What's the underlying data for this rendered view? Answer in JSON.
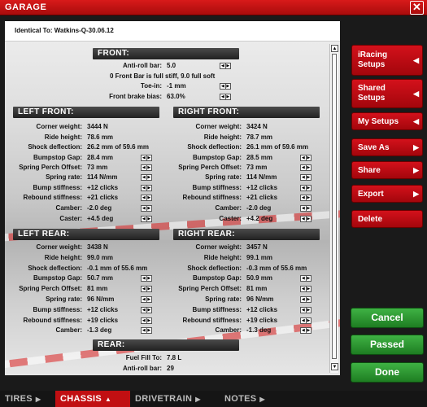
{
  "window": {
    "title": "GARAGE",
    "close": "✕"
  },
  "setup": {
    "identical_to": "Identical To: Watkins-Q-30.06.12"
  },
  "front": {
    "header": "FRONT:",
    "anti_roll_label": "Anti-roll bar:",
    "anti_roll_value": "5.0",
    "note": "0 Front Bar is full stiff, 9.0 full soft",
    "toe_label": "Toe-in:",
    "toe_value": "-1 mm",
    "brake_label": "Front brake bias:",
    "brake_value": "63.0%"
  },
  "left_front": {
    "header": "LEFT FRONT:",
    "rows": [
      {
        "label": "Corner weight:",
        "value": "3444 N"
      },
      {
        "label": "Ride height:",
        "value": "78.6 mm"
      },
      {
        "label": "Shock deflection:",
        "value": "26.2 mm  of  59.6 mm"
      },
      {
        "label": "Bumpstop Gap:",
        "value": "28.4 mm"
      },
      {
        "label": "Spring Perch Offset:",
        "value": "73 mm"
      },
      {
        "label": "Spring rate:",
        "value": "114 N/mm"
      },
      {
        "label": "Bump stiffness:",
        "value": "+12 clicks"
      },
      {
        "label": "Rebound stiffness:",
        "value": "+21 clicks"
      },
      {
        "label": "Camber:",
        "value": "-2.0 deg"
      },
      {
        "label": "Caster:",
        "value": "+4.5 deg"
      }
    ]
  },
  "right_front": {
    "header": "RIGHT FRONT:",
    "rows": [
      {
        "label": "Corner weight:",
        "value": "3424 N"
      },
      {
        "label": "Ride height:",
        "value": "78.7 mm"
      },
      {
        "label": "Shock deflection:",
        "value": "26.1 mm  of  59.6 mm"
      },
      {
        "label": "Bumpstop Gap:",
        "value": "28.5 mm"
      },
      {
        "label": "Spring Perch Offset:",
        "value": "73 mm"
      },
      {
        "label": "Spring rate:",
        "value": "114 N/mm"
      },
      {
        "label": "Bump stiffness:",
        "value": "+12 clicks"
      },
      {
        "label": "Rebound stiffness:",
        "value": "+21 clicks"
      },
      {
        "label": "Camber:",
        "value": "-2.0 deg"
      },
      {
        "label": "Caster:",
        "value": "+4.2 deg"
      }
    ]
  },
  "left_rear": {
    "header": "LEFT REAR:",
    "rows": [
      {
        "label": "Corner weight:",
        "value": "3438 N"
      },
      {
        "label": "Ride height:",
        "value": "99.0 mm"
      },
      {
        "label": "Shock deflection:",
        "value": "-0.1 mm  of  55.6 mm"
      },
      {
        "label": "Bumpstop Gap:",
        "value": "50.7 mm"
      },
      {
        "label": "Spring Perch Offset:",
        "value": "81 mm"
      },
      {
        "label": "Spring rate:",
        "value": "96 N/mm"
      },
      {
        "label": "Bump stiffness:",
        "value": "+12 clicks"
      },
      {
        "label": "Rebound stiffness:",
        "value": "+19 clicks"
      },
      {
        "label": "Camber:",
        "value": "-1.3 deg"
      }
    ]
  },
  "right_rear": {
    "header": "RIGHT REAR:",
    "rows": [
      {
        "label": "Corner weight:",
        "value": "3457 N"
      },
      {
        "label": "Ride height:",
        "value": "99.1 mm"
      },
      {
        "label": "Shock deflection:",
        "value": "-0.3 mm  of  55.6 mm"
      },
      {
        "label": "Bumpstop Gap:",
        "value": "50.9 mm"
      },
      {
        "label": "Spring Perch Offset:",
        "value": "81 mm"
      },
      {
        "label": "Spring rate:",
        "value": "96 N/mm"
      },
      {
        "label": "Bump stiffness:",
        "value": "+12 clicks"
      },
      {
        "label": "Rebound stiffness:",
        "value": "+19 clicks"
      },
      {
        "label": "Camber:",
        "value": "-1.3 deg"
      }
    ]
  },
  "rear": {
    "header": "REAR:",
    "fuel_label": "Fuel Fill To:",
    "fuel_value": "7.8 L",
    "arb_label": "Anti-roll bar:",
    "arb_value": "29"
  },
  "sidebar": {
    "iracing_setups": "iRacing Setups",
    "shared_setups": "Shared Setups",
    "my_setups": "My Setups",
    "save_as": "Save As",
    "share": "Share",
    "export": "Export",
    "delete": "Delete"
  },
  "actions": {
    "cancel": "Cancel",
    "passed": "Passed",
    "done": "Done"
  },
  "tabs": [
    {
      "label": "TIRES"
    },
    {
      "label": "CHASSIS"
    },
    {
      "label": "DRIVETRAIN"
    },
    {
      "label": "NOTES"
    }
  ],
  "colors": {
    "brand_red": "#c10f12",
    "action_green": "#2e9a33",
    "header_dark": "#2a2a2a"
  }
}
